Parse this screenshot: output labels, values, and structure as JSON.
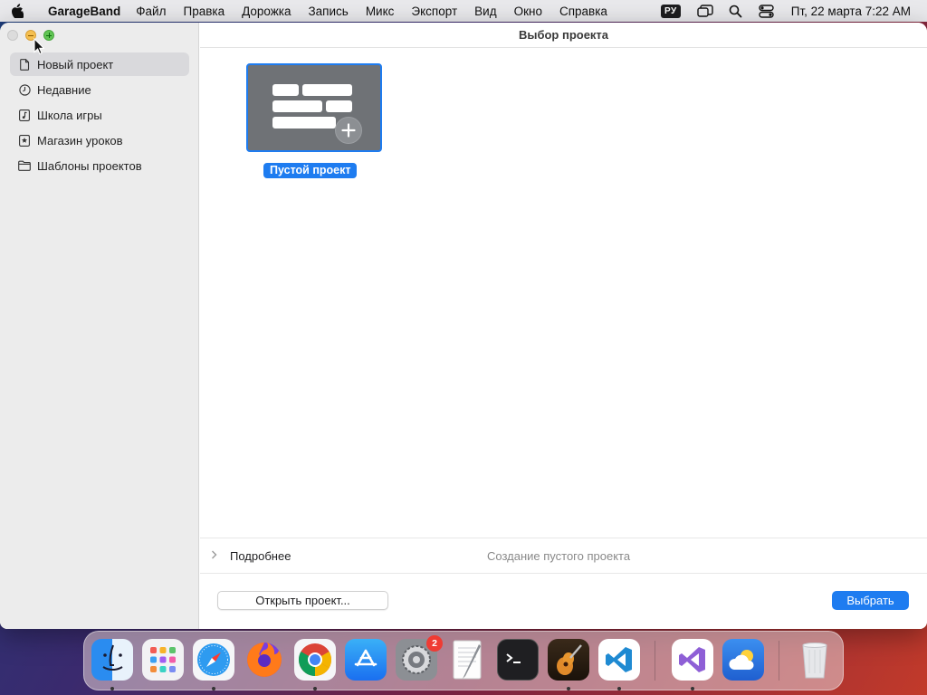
{
  "menubar": {
    "app_name": "GarageBand",
    "items": [
      "Файл",
      "Правка",
      "Дорожка",
      "Запись",
      "Микс",
      "Экспорт",
      "Вид",
      "Окно",
      "Справка"
    ],
    "input_language": "РУ",
    "clock": "Пт, 22 марта  7:22 AM"
  },
  "window": {
    "title": "Выбор проекта",
    "sidebar": {
      "items": [
        {
          "label": "Новый проект",
          "icon": "document-icon",
          "selected": true
        },
        {
          "label": "Недавние",
          "icon": "clock-icon",
          "selected": false
        },
        {
          "label": "Школа игры",
          "icon": "music-note-icon",
          "selected": false
        },
        {
          "label": "Магазин уроков",
          "icon": "star-icon",
          "selected": false
        },
        {
          "label": "Шаблоны проектов",
          "icon": "folder-icon",
          "selected": false
        }
      ]
    },
    "template": {
      "label": "Пустой проект",
      "selected": true
    },
    "details": {
      "label": "Подробнее",
      "description": "Создание пустого проекта"
    },
    "buttons": {
      "open": "Открыть проект...",
      "choose": "Выбрать"
    }
  },
  "dock": {
    "apps": [
      {
        "name": "Finder",
        "running": true
      },
      {
        "name": "Launchpad",
        "running": false
      },
      {
        "name": "Safari",
        "running": true
      },
      {
        "name": "Firefox",
        "running": false
      },
      {
        "name": "Chrome",
        "running": true
      },
      {
        "name": "App Store",
        "running": false
      },
      {
        "name": "System Settings",
        "running": false,
        "badge": "2"
      },
      {
        "name": "TextEdit",
        "running": false
      },
      {
        "name": "Terminal",
        "running": false
      },
      {
        "name": "GarageBand",
        "running": true
      },
      {
        "name": "Visual Studio Code",
        "running": true
      },
      {
        "name": "Visual Studio",
        "running": true
      },
      {
        "name": "Weather",
        "running": false
      },
      {
        "name": "Trash",
        "running": false
      }
    ]
  },
  "colors": {
    "accent": "#1e7cf0",
    "sidebar_bg": "#ececec",
    "selected_row": "#d9d9dc"
  }
}
